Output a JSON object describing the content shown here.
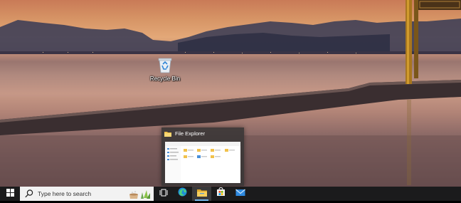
{
  "desktop": {
    "icons": [
      {
        "label": "Recycle Bin",
        "icon": "recycle-bin-icon"
      }
    ]
  },
  "preview": {
    "title": "File Explorer",
    "icon": "folder-icon"
  },
  "taskbar": {
    "start_icon": "windows-logo-icon",
    "search_placeholder": "Type here to search",
    "search_icon": "search-icon",
    "items": [
      {
        "name": "task-view",
        "icon": "task-view-icon"
      },
      {
        "name": "edge",
        "icon": "edge-icon"
      },
      {
        "name": "file-explorer",
        "icon": "folder-icon",
        "active": true
      },
      {
        "name": "microsoft-store",
        "icon": "store-icon"
      },
      {
        "name": "mail",
        "icon": "mail-icon"
      }
    ],
    "accent_color": "#76b9ed",
    "background_color": "#1b1b1c"
  }
}
